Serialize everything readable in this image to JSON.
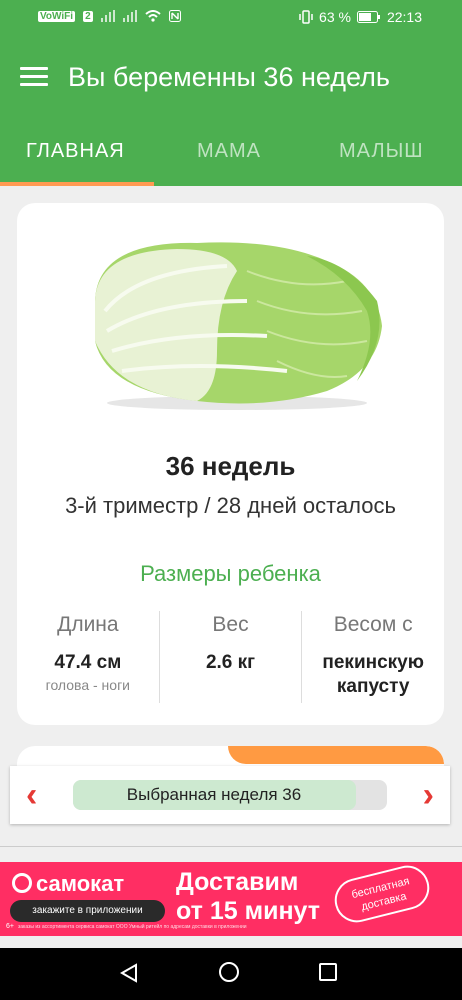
{
  "status_bar": {
    "left_labels": [
      "VoWiFi",
      "2"
    ],
    "battery": "63 %",
    "time": "22:13"
  },
  "app_bar": {
    "title": "Вы беременны 36 недель",
    "menu_icon": "hamburger-icon"
  },
  "tabs": [
    {
      "label": "ГЛАВНАЯ",
      "active": true
    },
    {
      "label": "МАМА",
      "active": false
    },
    {
      "label": "МАЛЫШ",
      "active": false
    }
  ],
  "week_card": {
    "image_icon": "napa-cabbage-image",
    "weeks_title": "36 недель",
    "trimester_line": "3-й триместр / 28 дней осталось",
    "sizes_title": "Размеры ребенка",
    "columns": [
      {
        "label": "Длина",
        "value": "47.4 см",
        "sub": "голова - ноги"
      },
      {
        "label": "Вес",
        "value": "2.6 кг",
        "sub": ""
      },
      {
        "label": "Весом с",
        "value": "пекинскую капусту",
        "sub": ""
      }
    ]
  },
  "week_selector": {
    "label": "Выбранная неделя 36",
    "progress": 0.9,
    "prev_icon": "chevron-left-icon",
    "next_icon": "chevron-right-icon"
  },
  "ad": {
    "brand": "самокат",
    "pill": "закажите в приложении",
    "headline_1": "Доставим",
    "headline_2": "от 15 минут",
    "stamp": "бесплатная доставка",
    "age": "6+",
    "fine_print": "заказы из ассортимента сервиса самокат ООО Умный ритейл по адресам доставки в приложении"
  },
  "colors": {
    "primary_green": "#4caf50",
    "tab_indicator": "#ff9a52",
    "arrow_red": "#e53935",
    "ad_pink": "#ff2e63"
  }
}
